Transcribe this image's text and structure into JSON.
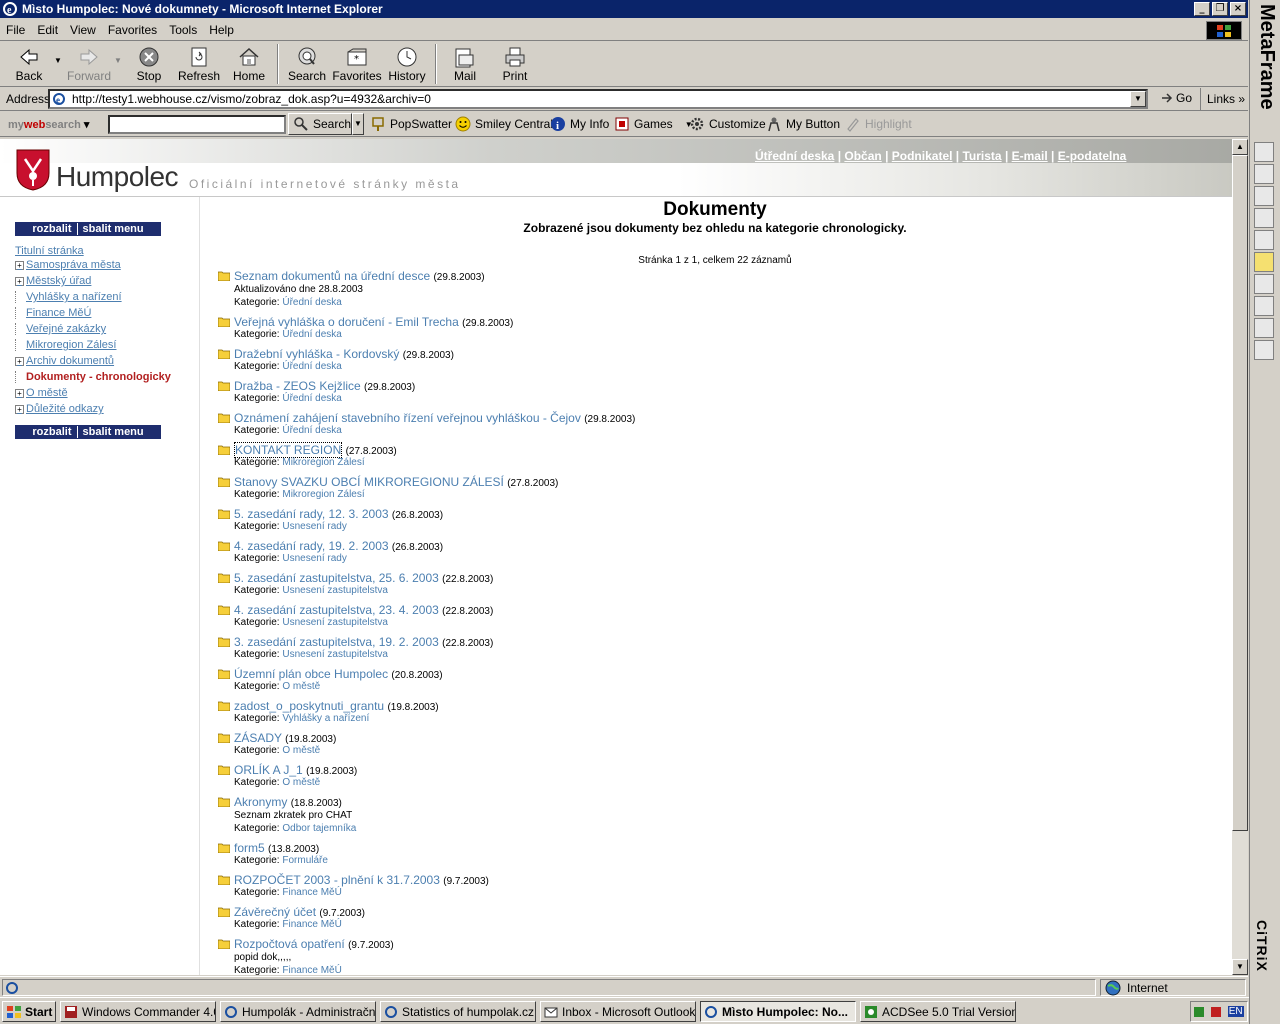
{
  "window": {
    "title": "Mìsto Humpolec: Nové dokumnety - Microsoft Internet Explorer"
  },
  "menu": [
    "File",
    "Edit",
    "View",
    "Favorites",
    "Tools",
    "Help"
  ],
  "toolbar": {
    "back": "Back",
    "forward": "Forward",
    "stop": "Stop",
    "refresh": "Refresh",
    "home": "Home",
    "search": "Search",
    "favorites": "Favorites",
    "history": "History",
    "mail": "Mail",
    "print": "Print"
  },
  "address": {
    "label": "Address",
    "url": "http://testy1.webhouse.cz/vismo/zobraz_dok.asp?u=4932&archiv=0",
    "go": "Go",
    "links": "Links"
  },
  "searchbar": {
    "brand_my": "my",
    "brand_web": "web",
    "brand_search": "search",
    "search_btn": "Search",
    "items": [
      "PopSwatter",
      "Smiley Central",
      "My Info",
      "Games",
      "Customize",
      "My Button",
      "Highlight"
    ]
  },
  "metaframe": {
    "label": "MetaFrame",
    "citrix": "CiTRiX"
  },
  "site": {
    "brand": "Humpolec",
    "tagline": "Oficiální internetové stránky města",
    "topnav": [
      "Útřední deska",
      "Občan",
      "Podnikatel",
      "Turista",
      "E-mail",
      "E-podatelna"
    ],
    "menu_expand": "rozbalit",
    "menu_collapse": "sbalit menu",
    "nav": [
      "Titulní stránka",
      "Samospráva města",
      "Městský úřad",
      "Vyhlášky a nařízení",
      "Finance MěÚ",
      "Veřejné zakázky",
      "Mikroregion Zálesí",
      "Archiv dokumentů",
      "Dokumenty - chronologicky",
      "O městě",
      "Důležité odkazy"
    ],
    "title": "Dokumenty",
    "subtitle": "Zobrazené jsou dokumenty bez ohledu na kategorie chronologicky.",
    "pager": "Stránka 1 z 1, celkem 22 záznamů",
    "cat_label": "Kategorie:",
    "documents": [
      {
        "title": "Seznam dokumentů na úřední desce",
        "date": "(29.8.2003)",
        "note": "Aktualizováno dne 28.8.2003",
        "category": "Úřední deska"
      },
      {
        "title": "Veřejná vyhláška o doručení - Emil Trecha",
        "date": "(29.8.2003)",
        "note": "",
        "category": "Úřední deska"
      },
      {
        "title": "Dražební vyhláška - Kordovský",
        "date": "(29.8.2003)",
        "note": "",
        "category": "Úřední deska"
      },
      {
        "title": "Dražba - ZEOS Kejžlice",
        "date": "(29.8.2003)",
        "note": "",
        "category": "Úřední deska"
      },
      {
        "title": "Oznámení zahájení stavebního řízení veřejnou vyhláškou - Čejov",
        "date": "(29.8.2003)",
        "note": "",
        "category": "Úřední deska"
      },
      {
        "title": "KONTAKT REGION",
        "date": "(27.8.2003)",
        "note": "",
        "category": "Mikroregion Zálesí"
      },
      {
        "title": "Stanovy SVAZKU OBCÍ MIKROREGIONU ZÁLESÍ",
        "date": "(27.8.2003)",
        "note": "",
        "category": "Mikroregion Zálesí"
      },
      {
        "title": "5. zasedání rady, 12. 3. 2003",
        "date": "(26.8.2003)",
        "note": "",
        "category": "Usnesení rady"
      },
      {
        "title": "4. zasedání rady, 19. 2. 2003",
        "date": "(26.8.2003)",
        "note": "",
        "category": "Usnesení rady"
      },
      {
        "title": "5. zasedání zastupitelstva, 25. 6. 2003",
        "date": "(22.8.2003)",
        "note": "",
        "category": "Usnesení zastupitelstva"
      },
      {
        "title": "4. zasedání zastupitelstva, 23. 4. 2003",
        "date": "(22.8.2003)",
        "note": "",
        "category": "Usnesení zastupitelstva"
      },
      {
        "title": "3. zasedání zastupitelstva, 19. 2. 2003",
        "date": "(22.8.2003)",
        "note": "",
        "category": "Usnesení zastupitelstva"
      },
      {
        "title": "Územní plán obce Humpolec",
        "date": "(20.8.2003)",
        "note": "",
        "category": "O městě"
      },
      {
        "title": "zadost_o_poskytnuti_grantu",
        "date": "(19.8.2003)",
        "note": "",
        "category": "Vyhlášky a nařízení"
      },
      {
        "title": "ZÁSADY",
        "date": "(19.8.2003)",
        "note": "",
        "category": "O městě"
      },
      {
        "title": "ORLÍK A J_1",
        "date": "(19.8.2003)",
        "note": "",
        "category": "O městě"
      },
      {
        "title": "Akronymy",
        "date": "(18.8.2003)",
        "note": "Seznam zkratek pro CHAT",
        "category": "Odbor tajemníka"
      },
      {
        "title": "form5",
        "date": "(13.8.2003)",
        "note": "",
        "category": "Formuláře"
      },
      {
        "title": "ROZPOČET 2003 - plnění k 31.7.2003",
        "date": "(9.7.2003)",
        "note": "",
        "category": "Finance MěÚ"
      },
      {
        "title": "Závěrečný účet",
        "date": "(9.7.2003)",
        "note": "",
        "category": "Finance MěÚ"
      },
      {
        "title": "Rozpočtová opatření",
        "date": "(9.7.2003)",
        "note": "popid dok,,,,,",
        "category": "Finance MěÚ"
      }
    ]
  },
  "status": {
    "zone": "Internet"
  },
  "taskbar": {
    "start": "Start",
    "tasks": [
      "Windows Commander 4.0 ...",
      "Humpolák - Administrační ...",
      "Statistics of humpolak.cz -...",
      "Inbox - Microsoft Outlook",
      "Mìsto Humpolec: No...",
      "ACDSee 5.0 Trial Version ..."
    ],
    "tray_lang": "EN"
  },
  "colors": {
    "ie_title": "#0a246a",
    "link": "#4c7fb0",
    "active_nav": "#b22020",
    "menu_btn": "#1e2d6e"
  }
}
